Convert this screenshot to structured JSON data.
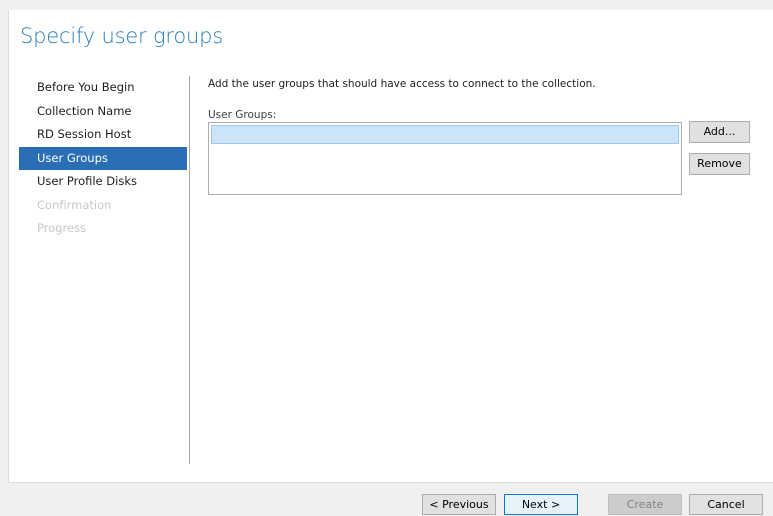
{
  "page": {
    "title": "Specify user groups"
  },
  "nav": {
    "items": [
      {
        "label": "Before You Begin",
        "state": "normal"
      },
      {
        "label": "Collection Name",
        "state": "normal"
      },
      {
        "label": "RD Session Host",
        "state": "normal"
      },
      {
        "label": "User Groups",
        "state": "active"
      },
      {
        "label": "User Profile Disks",
        "state": "normal"
      },
      {
        "label": "Confirmation",
        "state": "disabled"
      },
      {
        "label": "Progress",
        "state": "disabled"
      }
    ]
  },
  "main": {
    "instruction": "Add the user groups that should have access to connect to the collection.",
    "list_label": "User Groups:",
    "add_label": "Add...",
    "remove_label": "Remove"
  },
  "footer": {
    "previous_label": "< Previous",
    "next_label": "Next >",
    "create_label": "Create",
    "cancel_label": "Cancel"
  },
  "colors": {
    "title": "#2b7bb9",
    "nav_active_bg": "#2a6fb6",
    "disabled_text": "#c8c8c8",
    "selection_bg": "#cce4f7"
  }
}
